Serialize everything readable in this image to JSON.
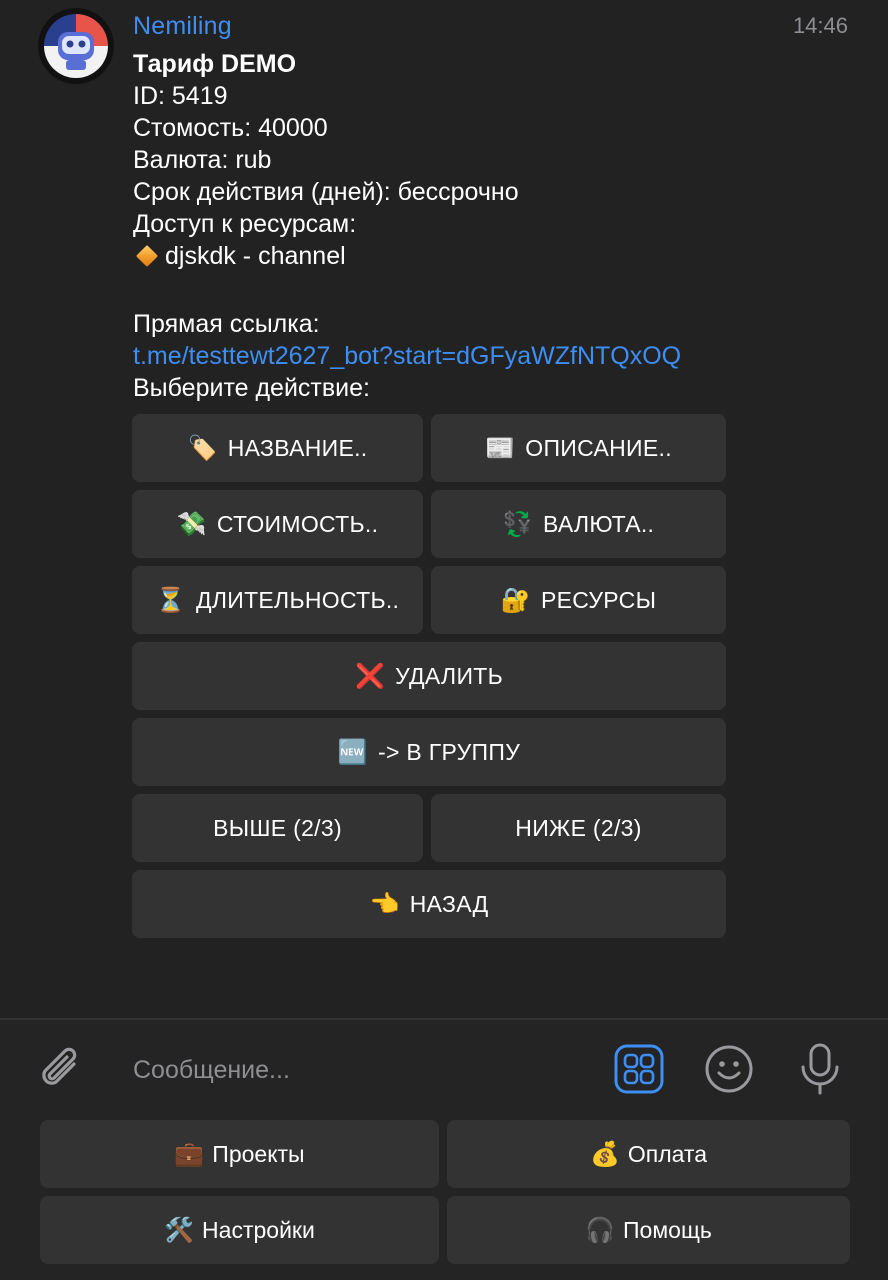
{
  "message": {
    "sender": "Nemiling",
    "time": "14:46",
    "lines": {
      "title": "Тариф DEMO",
      "id": "ID: 5419",
      "cost": "Стомость: 40000",
      "currency": "Валюта: rub",
      "duration": "Срок действия (дней): бессрочно",
      "resources_header": "Доступ к ресурсам:",
      "resource_item": "djskdk - channel",
      "direct_link_label": "Прямая ссылка:",
      "direct_link": "t.me/testtewt2627_bot?start=dGFyaWZfNTQxOQ",
      "choose_action": "Выберите действие:"
    }
  },
  "inline_keyboard": {
    "name": {
      "icon": "🏷️",
      "label": "НАЗВАНИЕ.."
    },
    "description": {
      "icon": "📰",
      "label": "ОПИСАНИЕ.."
    },
    "cost": {
      "icon": "💸",
      "label": "СТОИМОСТЬ.."
    },
    "currency": {
      "icon": "💱",
      "label": "ВАЛЮТА.."
    },
    "duration": {
      "icon": "⏳",
      "label": "ДЛИТЕЛЬНОСТЬ.."
    },
    "resources": {
      "icon": "🔐",
      "label": "РЕСУРСЫ"
    },
    "delete": {
      "icon": "❌",
      "label": "УДАЛИТЬ"
    },
    "to_group": {
      "icon": "🆕",
      "label": "-> В ГРУППУ"
    },
    "up": {
      "label": "ВЫШЕ (2/3)"
    },
    "down": {
      "label": "НИЖЕ (2/3)"
    },
    "back": {
      "icon": "👈",
      "label": "НАЗАД"
    }
  },
  "composer": {
    "placeholder": "Сообщение...",
    "accent_color": "#3d8ef5"
  },
  "reply_keyboard": {
    "projects": {
      "icon": "💼",
      "label": "Проекты"
    },
    "payment": {
      "icon": "💰",
      "label": "Оплата"
    },
    "settings": {
      "icon": "🛠️",
      "label": "Настройки"
    },
    "help": {
      "icon": "🎧",
      "label": "Помощь"
    }
  },
  "icons": {
    "attach": "paperclip-icon",
    "commands": "bot-commands-icon",
    "emoji": "smiley-icon",
    "mic": "microphone-icon"
  }
}
